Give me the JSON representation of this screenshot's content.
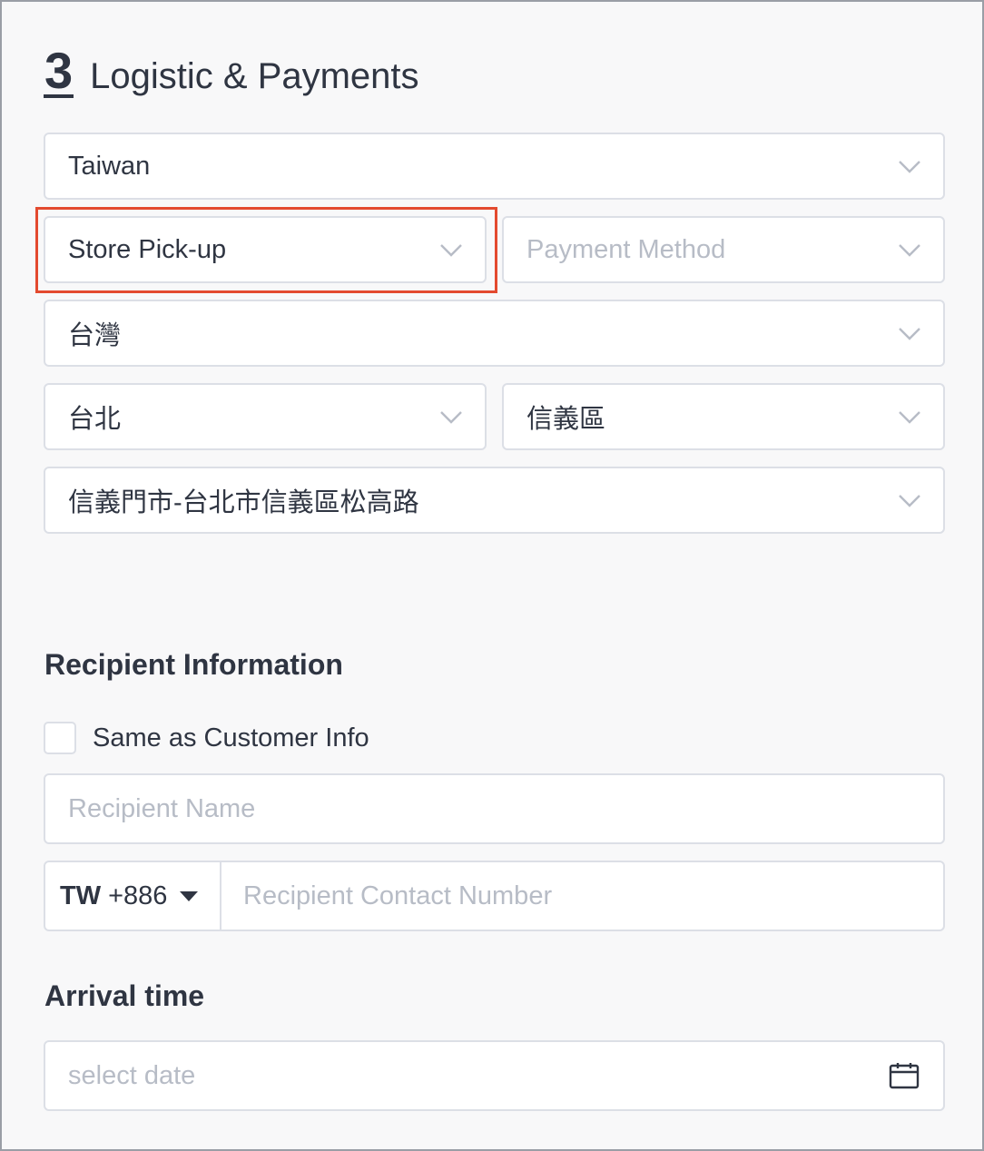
{
  "section": {
    "step": "3",
    "title": "Logistic & Payments"
  },
  "logistics": {
    "country": "Taiwan",
    "shipping_method": "Store Pick-up",
    "payment_placeholder": "Payment Method",
    "region": "台灣",
    "city": "台北",
    "district": "信義區",
    "store": "信義門市-台北市信義區松高路"
  },
  "recipient": {
    "title": "Recipient Information",
    "same_as_label": "Same as Customer Info",
    "same_as_checked": false,
    "name_placeholder": "Recipient Name",
    "phone_country": "TW",
    "phone_code": "+886",
    "phone_placeholder": "Recipient Contact Number"
  },
  "arrival": {
    "title": "Arrival time",
    "date_placeholder": "select date"
  },
  "colors": {
    "highlight": "#e34a2f",
    "text": "#2f3542",
    "placeholder": "#b7bcc6",
    "border": "#dcdfe6"
  }
}
